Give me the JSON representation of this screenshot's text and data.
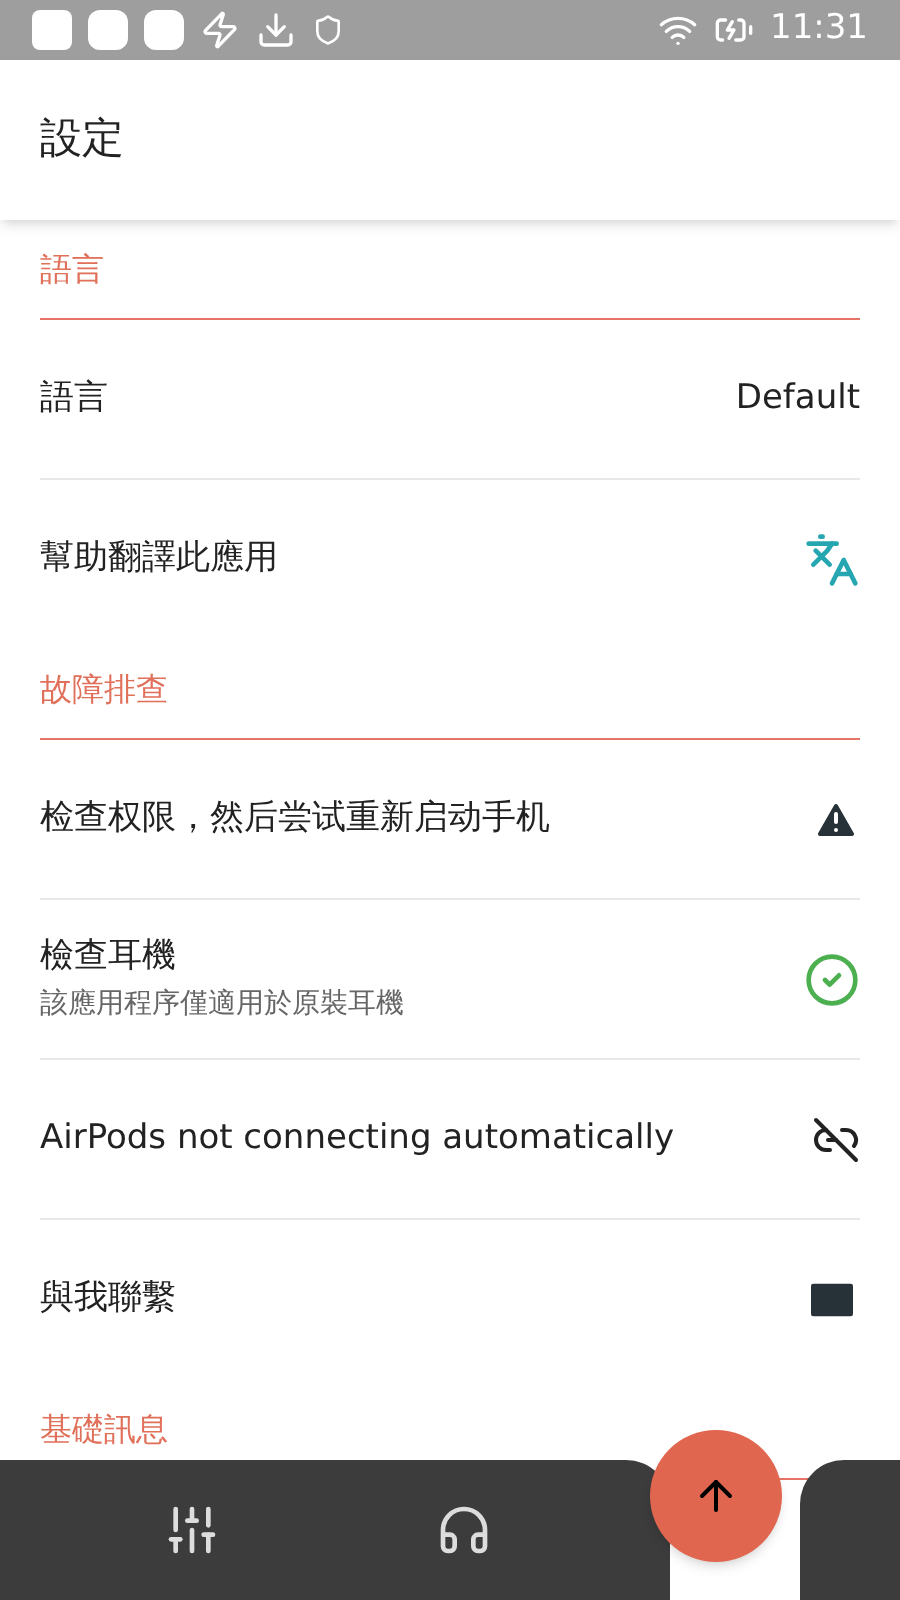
{
  "status_bar": {
    "time": "11:31"
  },
  "app_bar": {
    "title": "設定"
  },
  "sections": [
    {
      "title": "語言",
      "items": [
        {
          "kind": "value",
          "label": "語言",
          "value": "Default"
        },
        {
          "kind": "icon",
          "label": "幫助翻譯此應用"
        }
      ]
    },
    {
      "title": "故障排查",
      "items": [
        {
          "kind": "icon",
          "label": "检查权限，然后尝试重新启动手机"
        },
        {
          "kind": "icon",
          "label": "檢查耳機",
          "subtitle": "該應用程序僅適用於原裝耳機"
        },
        {
          "kind": "icon",
          "label": "AirPods not connecting automatically"
        },
        {
          "kind": "icon",
          "label": "與我聯繫"
        }
      ]
    },
    {
      "title": "基礎訊息"
    }
  ]
}
